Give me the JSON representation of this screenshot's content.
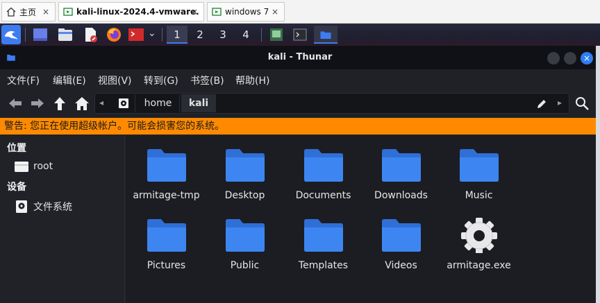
{
  "browser_tabs": [
    {
      "label": "主页",
      "icon": "home-icon"
    },
    {
      "label": "kali-linux-2024.4-vmware...",
      "icon": "vm-icon"
    },
    {
      "label": "windows 7",
      "icon": "vm-icon"
    }
  ],
  "tab_close_glyph": "×",
  "panel": {
    "workspaces": [
      "1",
      "2",
      "3",
      "4"
    ],
    "active_workspace": "1",
    "menu_icon": "kali-dragon-icon",
    "chevron": "⌄"
  },
  "window": {
    "title": "kali - Thunar",
    "close_glyph": "×"
  },
  "menubar": [
    "文件(F)",
    "编辑(E)",
    "视图(V)",
    "转到(G)",
    "书签(B)",
    "帮助(H)"
  ],
  "pathbar": {
    "crumbs": [
      "home",
      "kali"
    ],
    "active": "kali",
    "left_arrow": "◂",
    "right_arrow": "▸"
  },
  "warning": "警告: 您正在使用超级帐户。可能会损害您的系统。",
  "sidebar": {
    "places_heading": "位置",
    "places": [
      "root"
    ],
    "devices_heading": "设备",
    "devices": [
      "文件系统"
    ]
  },
  "files": [
    {
      "name": "armitage-tmp",
      "type": "folder"
    },
    {
      "name": "Desktop",
      "type": "folder"
    },
    {
      "name": "Documents",
      "type": "folder"
    },
    {
      "name": "Downloads",
      "type": "folder"
    },
    {
      "name": "Music",
      "type": "folder"
    },
    {
      "name": "Pictures",
      "type": "folder"
    },
    {
      "name": "Public",
      "type": "folder"
    },
    {
      "name": "Templates",
      "type": "folder"
    },
    {
      "name": "Videos",
      "type": "folder"
    },
    {
      "name": "armitage.exe",
      "type": "executable"
    }
  ],
  "colors": {
    "accent": "#2f7df3",
    "warning_bg": "#ff8a00",
    "folder": "#3b82f6"
  }
}
